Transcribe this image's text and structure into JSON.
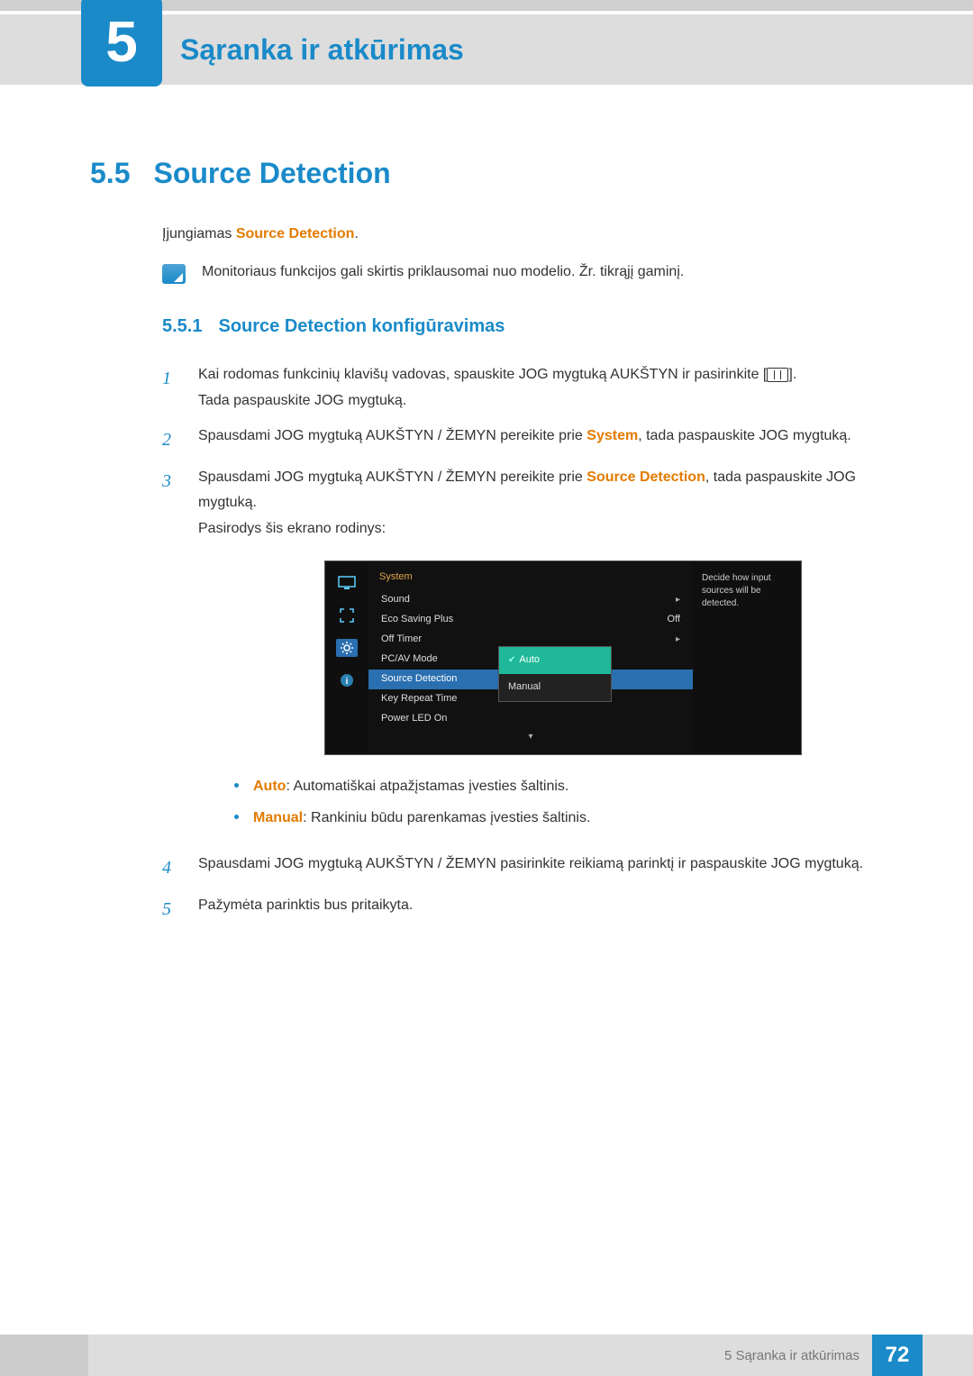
{
  "chapter": {
    "number": "5",
    "title": "Sąranka ir atkūrimas"
  },
  "section": {
    "number": "5.5",
    "title": "Source Detection"
  },
  "intro": {
    "prefix": "Įjungiamas ",
    "highlight": "Source Detection",
    "suffix": "."
  },
  "note": "Monitoriaus funkcijos gali skirtis priklausomai nuo modelio. Žr. tikrąjį gaminį.",
  "subsection": {
    "number": "5.5.1",
    "title": "Source Detection konfigūravimas"
  },
  "steps": {
    "s1": {
      "n": "1",
      "line1a": "Kai rodomas funkcinių klavišų vadovas, spauskite JOG mygtuką AUKŠTYN ir pasirinkite [",
      "line1b": "].",
      "line2": "Tada paspauskite JOG mygtuką."
    },
    "s2": {
      "n": "2",
      "a": "Spausdami JOG mygtuką AUKŠTYN / ŽEMYN pereikite prie ",
      "hl": "System",
      "b": ", tada paspauskite JOG mygtuką."
    },
    "s3": {
      "n": "3",
      "a": "Spausdami JOG mygtuką AUKŠTYN / ŽEMYN pereikite prie ",
      "hl": "Source Detection",
      "b": ", tada paspauskite JOG mygtuką.",
      "c": "Pasirodys šis ekrano rodinys:"
    },
    "s4": {
      "n": "4",
      "text": "Spausdami JOG mygtuką AUKŠTYN / ŽEMYN pasirinkite reikiamą parinktį ir paspauskite JOG mygtuką."
    },
    "s5": {
      "n": "5",
      "text": "Pažymėta parinktis bus pritaikyta."
    }
  },
  "bullets": {
    "b1": {
      "hl": "Auto",
      "rest": ": Automatiškai atpažįstamas įvesties šaltinis."
    },
    "b2": {
      "hl": "Manual",
      "rest": ": Rankiniu būdu parenkamas įvesties šaltinis."
    }
  },
  "osd": {
    "header": "System",
    "items": {
      "sound": "Sound",
      "eco": "Eco Saving Plus",
      "eco_val": "Off",
      "offtimer": "Off Timer",
      "pcav": "PC/AV Mode",
      "source": "Source Detection",
      "keyrepeat": "Key Repeat Time",
      "powerled": "Power LED On"
    },
    "options": {
      "auto": "Auto",
      "manual": "Manual"
    },
    "desc": "Decide how input sources will be detected.",
    "arrow_right": "▸",
    "arrow_down": "▾",
    "check": "✔"
  },
  "footer": {
    "text": "5 Sąranka ir atkūrimas",
    "page": "72"
  }
}
